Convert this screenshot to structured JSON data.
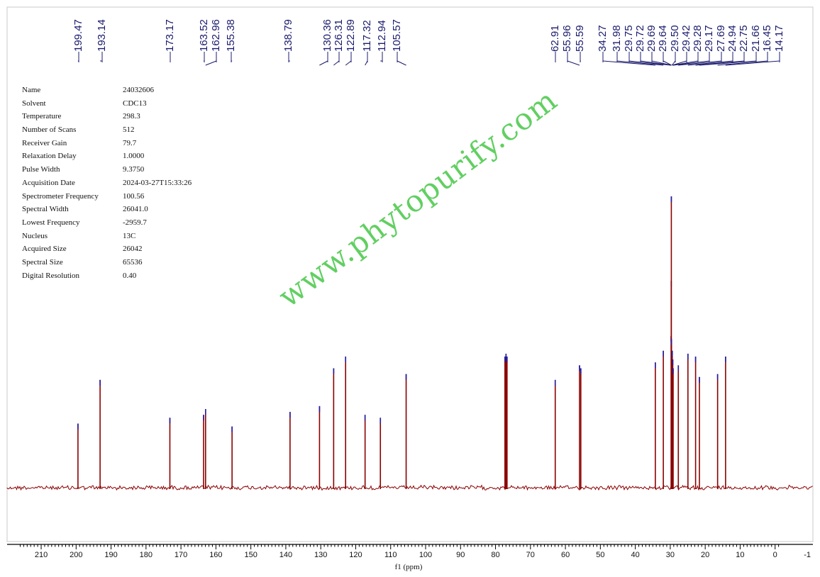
{
  "parameters": [
    {
      "key": "Name",
      "value": "24032606"
    },
    {
      "key": "Solvent",
      "value": "CDC13"
    },
    {
      "key": "Temperature",
      "value": "298.3"
    },
    {
      "key": "Number of Scans",
      "value": "512"
    },
    {
      "key": "Receiver Gain",
      "value": "79.7"
    },
    {
      "key": "Relaxation Delay",
      "value": "1.0000"
    },
    {
      "key": "Pulse Width",
      "value": "9.3750"
    },
    {
      "key": "Acquisition Date",
      "value": "2024-03-27T15:33:26"
    },
    {
      "key": "Spectrometer Frequency",
      "value": "100.56"
    },
    {
      "key": "Spectral Width",
      "value": "26041.0"
    },
    {
      "key": "Lowest Frequency",
      "value": "-2959.7"
    },
    {
      "key": "Nucleus",
      "value": "13C"
    },
    {
      "key": "Acquired Size",
      "value": "26042"
    },
    {
      "key": "Spectral Size",
      "value": "65536"
    },
    {
      "key": "Digital Resolution",
      "value": "0.40"
    }
  ],
  "watermark": "www.phytopurify.com",
  "colors": {
    "spectrum": "#8b0000",
    "peak_marker": "#1f1fa8",
    "label": "#1a1a6e",
    "watermark": "#3cc43c"
  },
  "chart_data": {
    "type": "line",
    "title": "",
    "xlabel": "f1 (ppm)",
    "ylabel": "",
    "x_reversed": true,
    "xlim": [
      -1,
      216
    ],
    "x_ticks": [
      210,
      200,
      190,
      180,
      170,
      160,
      150,
      140,
      130,
      120,
      110,
      100,
      90,
      80,
      70,
      60,
      50,
      40,
      30,
      20,
      10,
      0,
      -10
    ],
    "x_tick_labels": [
      "210",
      "200",
      "190",
      "180",
      "170",
      "160",
      "150",
      "140",
      "130",
      "120",
      "110",
      "100",
      "90",
      "80",
      "70",
      "60",
      "50",
      "40",
      "30",
      "20",
      "10",
      "0",
      "-1"
    ],
    "ylim": [
      0,
      1
    ],
    "peak_labels": [
      "199.47",
      "193.14",
      "173.17",
      "163.52",
      "162.96",
      "155.38",
      "138.79",
      "130.36",
      "126.31",
      "122.89",
      "117.32",
      "112.94",
      "105.57",
      "62.91",
      "55.96",
      "55.59",
      "34.27",
      "31.98",
      "29.75",
      "29.72",
      "29.69",
      "29.64",
      "29.50",
      "29.42",
      "29.28",
      "29.17",
      "27.69",
      "24.94",
      "22.75",
      "21.66",
      "16.45",
      "14.17"
    ],
    "peaks": [
      {
        "ppm": 199.47,
        "height": 0.22
      },
      {
        "ppm": 193.14,
        "height": 0.37
      },
      {
        "ppm": 173.17,
        "height": 0.24
      },
      {
        "ppm": 163.52,
        "height": 0.25
      },
      {
        "ppm": 162.96,
        "height": 0.27
      },
      {
        "ppm": 155.38,
        "height": 0.21
      },
      {
        "ppm": 138.79,
        "height": 0.26
      },
      {
        "ppm": 130.36,
        "height": 0.28
      },
      {
        "ppm": 126.31,
        "height": 0.41
      },
      {
        "ppm": 122.89,
        "height": 0.45
      },
      {
        "ppm": 117.32,
        "height": 0.25
      },
      {
        "ppm": 112.94,
        "height": 0.24
      },
      {
        "ppm": 105.57,
        "height": 0.39
      },
      {
        "ppm": 77.3,
        "height": 0.45
      },
      {
        "ppm": 77.0,
        "height": 0.46
      },
      {
        "ppm": 76.7,
        "height": 0.45
      },
      {
        "ppm": 62.91,
        "height": 0.37
      },
      {
        "ppm": 55.96,
        "height": 0.42
      },
      {
        "ppm": 55.59,
        "height": 0.41
      },
      {
        "ppm": 34.27,
        "height": 0.43
      },
      {
        "ppm": 31.98,
        "height": 0.47
      },
      {
        "ppm": 29.75,
        "height": 0.52
      },
      {
        "ppm": 29.72,
        "height": 0.71
      },
      {
        "ppm": 29.69,
        "height": 1.0
      },
      {
        "ppm": 29.64,
        "height": 0.51
      },
      {
        "ppm": 29.5,
        "height": 0.46
      },
      {
        "ppm": 29.42,
        "height": 0.47
      },
      {
        "ppm": 29.28,
        "height": 0.44
      },
      {
        "ppm": 29.17,
        "height": 0.41
      },
      {
        "ppm": 27.69,
        "height": 0.42
      },
      {
        "ppm": 24.94,
        "height": 0.46
      },
      {
        "ppm": 22.75,
        "height": 0.45
      },
      {
        "ppm": 21.66,
        "height": 0.38
      },
      {
        "ppm": 16.45,
        "height": 0.39
      },
      {
        "ppm": 14.17,
        "height": 0.45
      }
    ]
  }
}
